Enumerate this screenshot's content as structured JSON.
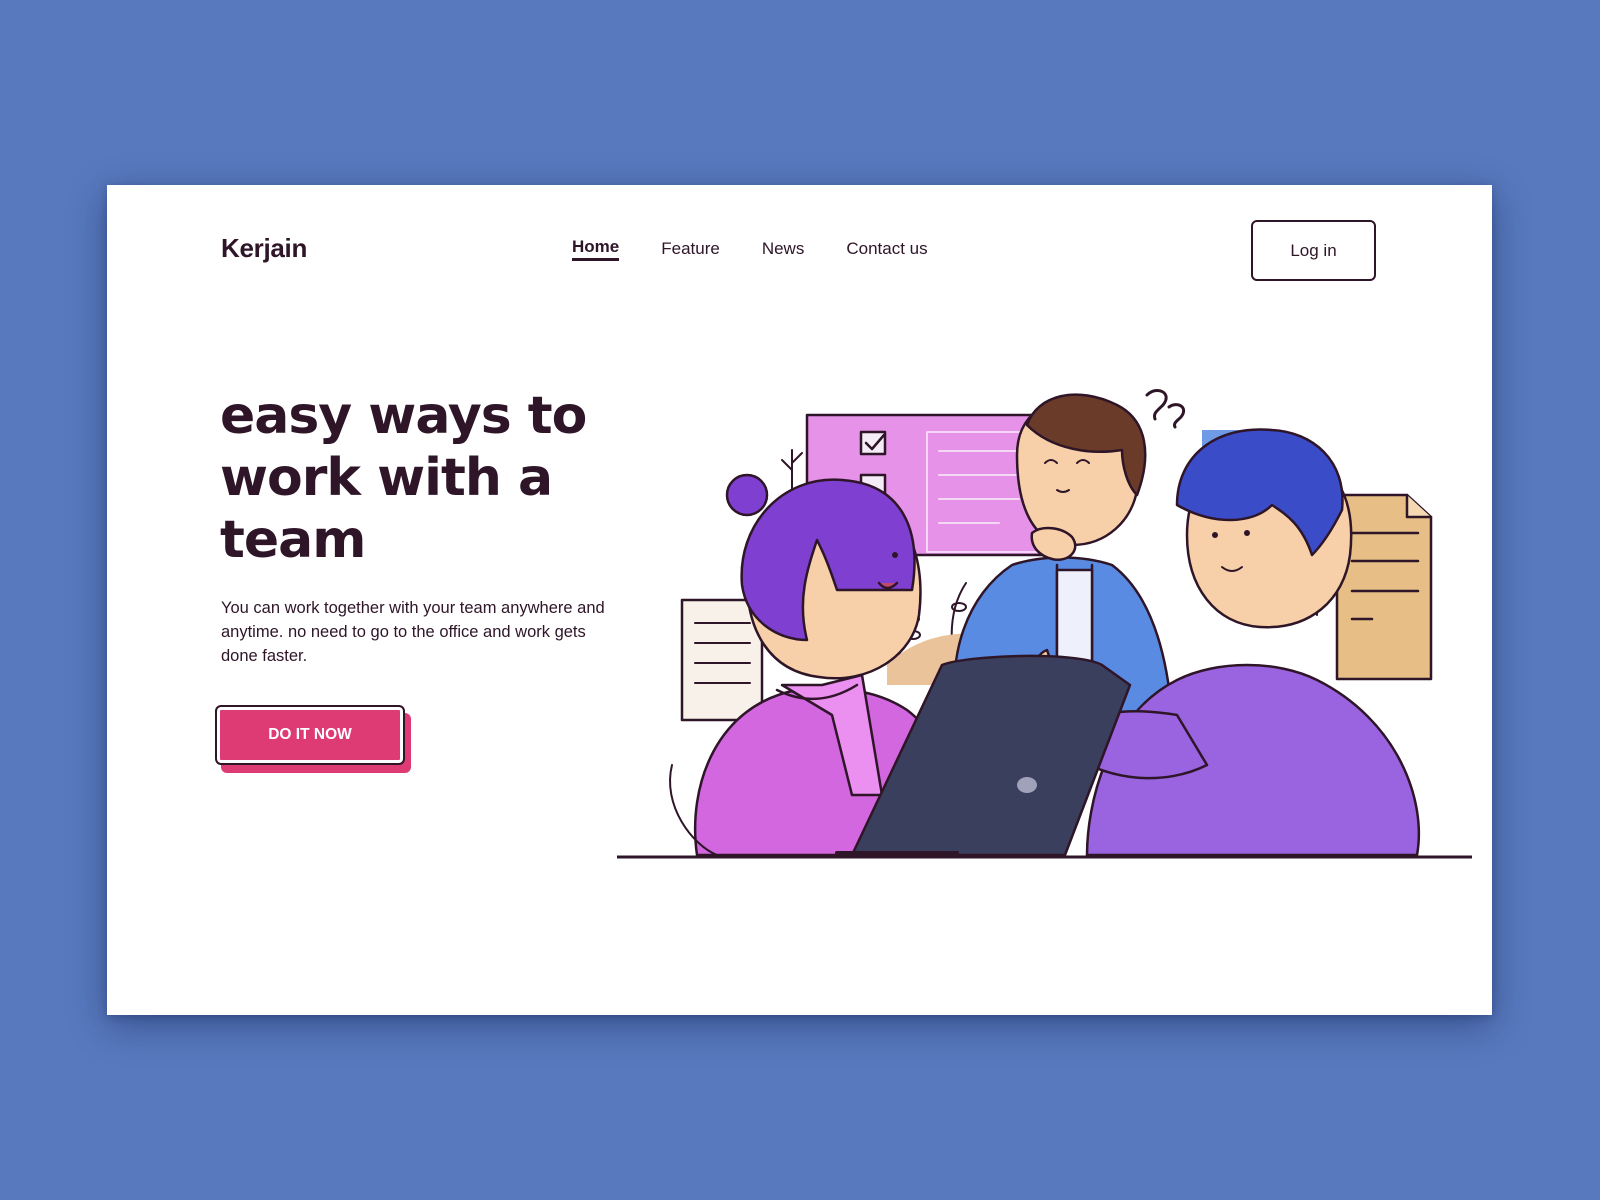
{
  "brand": {
    "name": "Kerjain"
  },
  "nav": {
    "items": [
      {
        "label": "Home",
        "active": true
      },
      {
        "label": "Feature",
        "active": false
      },
      {
        "label": "News",
        "active": false
      },
      {
        "label": "Contact us",
        "active": false
      }
    ]
  },
  "header": {
    "login_label": "Log in"
  },
  "hero": {
    "title": "easy ways to work with a team",
    "description": "You can work together with your team anywhere and anytime. no need to go to the office and work gets done faster.",
    "cta_label": "DO IT NOW"
  },
  "colors": {
    "page_background": "#5879be",
    "card_background": "#ffffff",
    "text_dark": "#2e1528",
    "cta": "#de3b74",
    "illustration_purple": "#9a52d6",
    "illustration_blue": "#3f6fd8",
    "illustration_paper": "#e6be86"
  },
  "illustration": {
    "subject": "three people collaborating around a laptop"
  }
}
